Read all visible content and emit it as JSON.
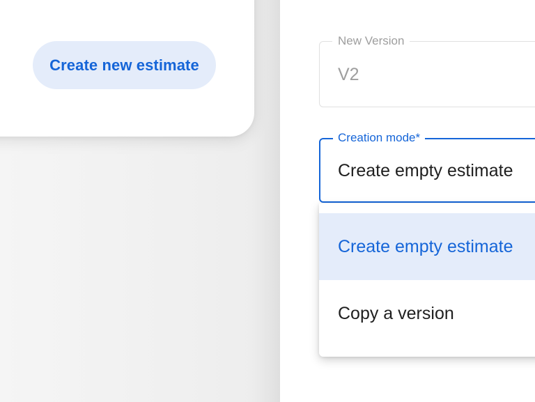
{
  "left_card": {
    "create_button_label": "Create new estimate"
  },
  "form": {
    "version_field": {
      "label": "New Version",
      "value": "V2"
    },
    "mode_field": {
      "label": "Creation mode*",
      "value": "Create empty estimate"
    },
    "mode_options": [
      {
        "label": "Create empty estimate",
        "selected": true
      },
      {
        "label": "Copy a version",
        "selected": false
      }
    ]
  },
  "colors": {
    "accent": "#1565d8",
    "selected_bg": "#e4ecfa",
    "muted_text": "#9e9e9e"
  }
}
